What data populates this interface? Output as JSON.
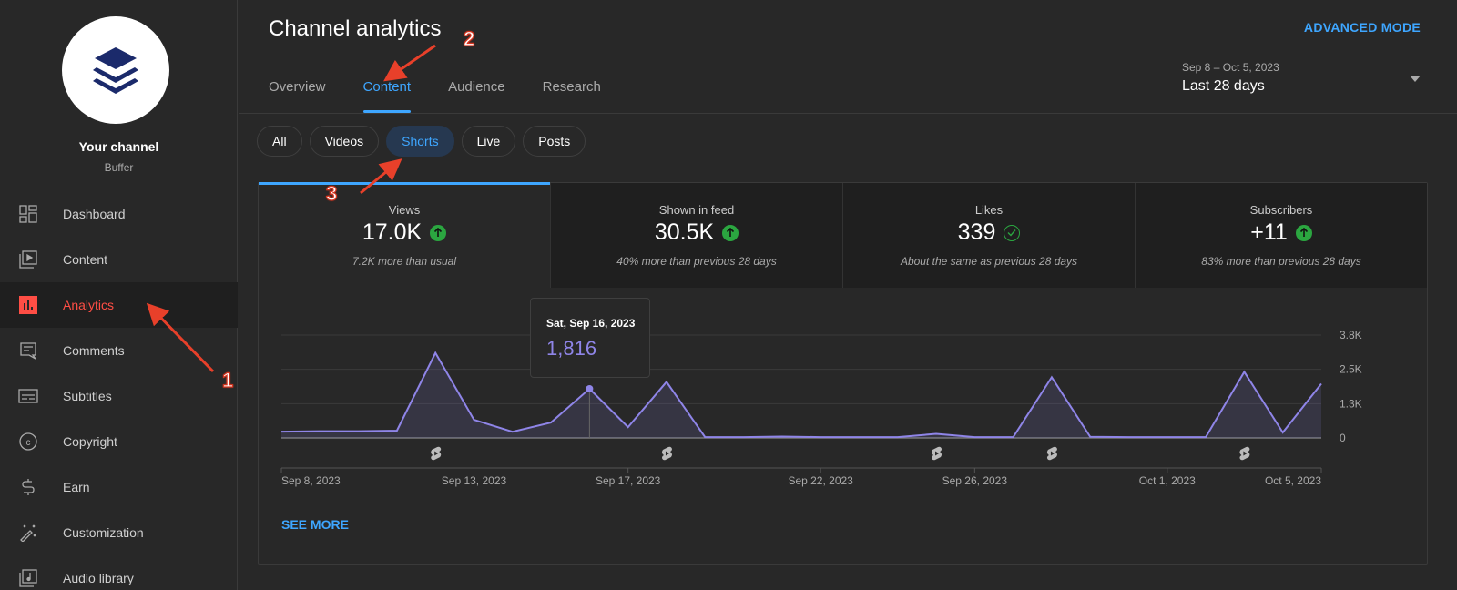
{
  "sidebar": {
    "channel_title": "Your channel",
    "channel_name": "Buffer",
    "logo": "buffer-layers-logo",
    "items": [
      {
        "label": "Dashboard",
        "icon": "dashboard-icon",
        "active": false
      },
      {
        "label": "Content",
        "icon": "content-icon",
        "active": false
      },
      {
        "label": "Analytics",
        "icon": "analytics-icon",
        "active": true
      },
      {
        "label": "Comments",
        "icon": "comments-icon",
        "active": false
      },
      {
        "label": "Subtitles",
        "icon": "subtitles-icon",
        "active": false
      },
      {
        "label": "Copyright",
        "icon": "copyright-icon",
        "active": false
      },
      {
        "label": "Earn",
        "icon": "dollar-icon",
        "active": false
      },
      {
        "label": "Customization",
        "icon": "magic-wand-icon",
        "active": false
      },
      {
        "label": "Audio library",
        "icon": "audio-library-icon",
        "active": false
      }
    ]
  },
  "header": {
    "title": "Channel analytics",
    "advanced_mode": "ADVANCED MODE",
    "tabs": [
      {
        "label": "Overview",
        "active": false
      },
      {
        "label": "Content",
        "active": true
      },
      {
        "label": "Audience",
        "active": false
      },
      {
        "label": "Research",
        "active": false
      }
    ],
    "date_picker": {
      "range": "Sep 8 – Oct 5, 2023",
      "label": "Last 28 days"
    }
  },
  "filters": {
    "chips": [
      {
        "label": "All",
        "active": false
      },
      {
        "label": "Videos",
        "active": false
      },
      {
        "label": "Shorts",
        "active": true
      },
      {
        "label": "Live",
        "active": false
      },
      {
        "label": "Posts",
        "active": false
      }
    ]
  },
  "metrics": [
    {
      "label": "Views",
      "value": "17.0K",
      "status": "up",
      "sub": "7.2K more than usual",
      "active": true
    },
    {
      "label": "Shown in feed",
      "value": "30.5K",
      "status": "up",
      "sub": "40% more than previous 28 days",
      "active": false
    },
    {
      "label": "Likes",
      "value": "339",
      "status": "same",
      "sub": "About the same as previous 28 days",
      "active": false
    },
    {
      "label": "Subscribers",
      "value": "+11",
      "status": "up",
      "sub": "83% more than previous 28 days",
      "active": false
    }
  ],
  "tooltip": {
    "date": "Sat, Sep 16, 2023",
    "value": "1,816"
  },
  "see_more": "SEE MORE",
  "annotations": [
    "1",
    "2",
    "3"
  ],
  "colors": {
    "accent": "#3ea6ff",
    "active_nav": "#ff4e45",
    "series": "#8f85e8",
    "up": "#2ba640"
  },
  "chart_data": {
    "type": "area",
    "title": "Views",
    "xlabel": "",
    "ylabel": "",
    "x": [
      "Sep 8",
      "Sep 9",
      "Sep 10",
      "Sep 11",
      "Sep 12",
      "Sep 13",
      "Sep 14",
      "Sep 15",
      "Sep 16",
      "Sep 17",
      "Sep 18",
      "Sep 19",
      "Sep 20",
      "Sep 21",
      "Sep 22",
      "Sep 23",
      "Sep 24",
      "Sep 25",
      "Sep 26",
      "Sep 27",
      "Sep 28",
      "Sep 29",
      "Sep 30",
      "Oct 1",
      "Oct 2",
      "Oct 3",
      "Oct 4",
      "Oct 5"
    ],
    "series": [
      {
        "name": "Views",
        "values": [
          230,
          250,
          250,
          270,
          3140,
          670,
          230,
          570,
          1816,
          400,
          2070,
          30,
          30,
          50,
          30,
          30,
          30,
          150,
          30,
          30,
          2240,
          40,
          30,
          30,
          30,
          2440,
          200,
          2000
        ]
      }
    ],
    "ylim": [
      0,
      3800
    ],
    "y_ticks": [
      "0",
      "1.3K",
      "2.5K",
      "3.8K"
    ],
    "y_tick_values": [
      0,
      1267,
      2533,
      3800
    ],
    "x_tick_labels": [
      "Sep 8, 2023",
      "Sep 13, 2023",
      "Sep 17, 2023",
      "Sep 22, 2023",
      "Sep 26, 2023",
      "Oct 1, 2023",
      "Oct 5, 2023"
    ],
    "x_tick_index": [
      0,
      5,
      9,
      14,
      18,
      23,
      27
    ],
    "shorts_upload_index": [
      4,
      10,
      17,
      20,
      25
    ],
    "highlight_index": 8,
    "grid": true,
    "y_axis_position": "right"
  }
}
